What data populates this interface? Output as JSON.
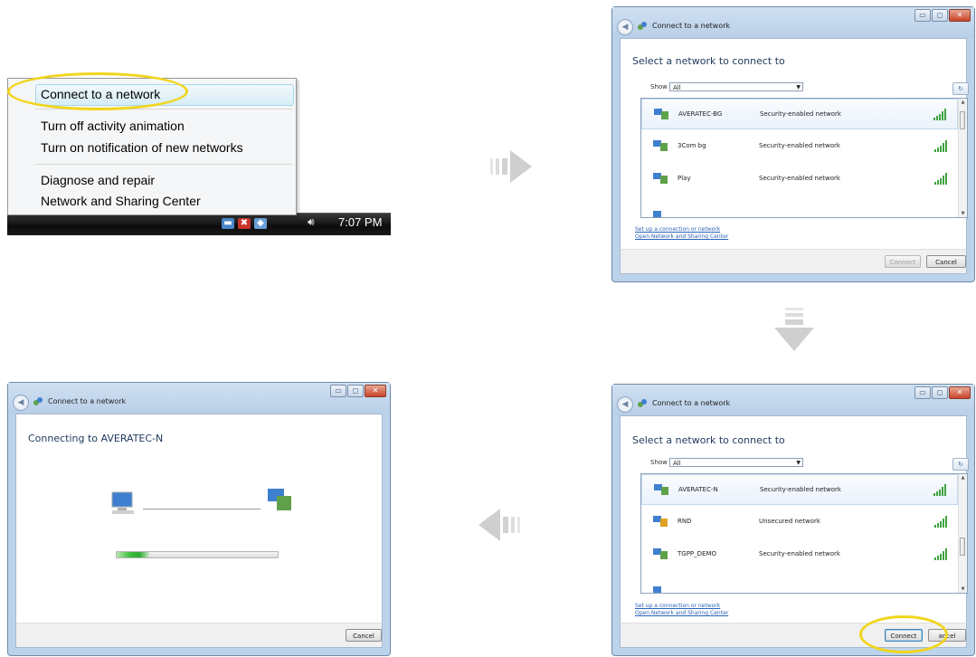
{
  "context_menu": {
    "items": [
      {
        "label": "Connect to a network"
      },
      {
        "label": "Turn off activity animation"
      },
      {
        "label": "Turn on notification of new networks"
      },
      {
        "label": "Diagnose and repair"
      },
      {
        "label": "Network and Sharing Center"
      }
    ]
  },
  "taskbar": {
    "clock": "7:07 PM",
    "icons": [
      "network-tray-icon",
      "shield-tray-icon",
      "network-warning-tray-icon",
      "speaker-icon"
    ]
  },
  "dialog_select_1": {
    "title": "Connect to a network",
    "heading": "Select a network to connect to",
    "show_label": "Show",
    "show_value": "All",
    "networks": [
      {
        "name": "AVERATEC-BG",
        "security": "Security-enabled network"
      },
      {
        "name": "3Com bg",
        "security": "Security-enabled network"
      },
      {
        "name": "Play",
        "security": "Security-enabled network"
      }
    ],
    "links": [
      "Set up a connection or network",
      "Open Network and Sharing Center"
    ],
    "connect_label": "Connect",
    "cancel_label": "Cancel"
  },
  "dialog_select_2": {
    "title": "Connect to a network",
    "heading": "Select a network to connect to",
    "show_label": "Show",
    "show_value": "All",
    "networks": [
      {
        "name": "AVERATEC-N",
        "security": "Security-enabled network"
      },
      {
        "name": "RND",
        "security": "Unsecured network"
      },
      {
        "name": "TGPP_DEMO",
        "security": "Security-enabled network"
      }
    ],
    "links": [
      "Set up a connection or network",
      "Open Network and Sharing Center"
    ],
    "connect_label": "Connect",
    "cancel_label": "ancel"
  },
  "dialog_connecting": {
    "title": "Connect to a network",
    "heading": "Connecting to AVERATEC-N",
    "progress": 0.2,
    "cancel_label": "Cancel"
  },
  "colors": {
    "highlight_ring": "#f1d51b",
    "progress_green": "#3fbf3f",
    "link_blue": "#2b63b6",
    "heading_blue": "#1e395b"
  }
}
